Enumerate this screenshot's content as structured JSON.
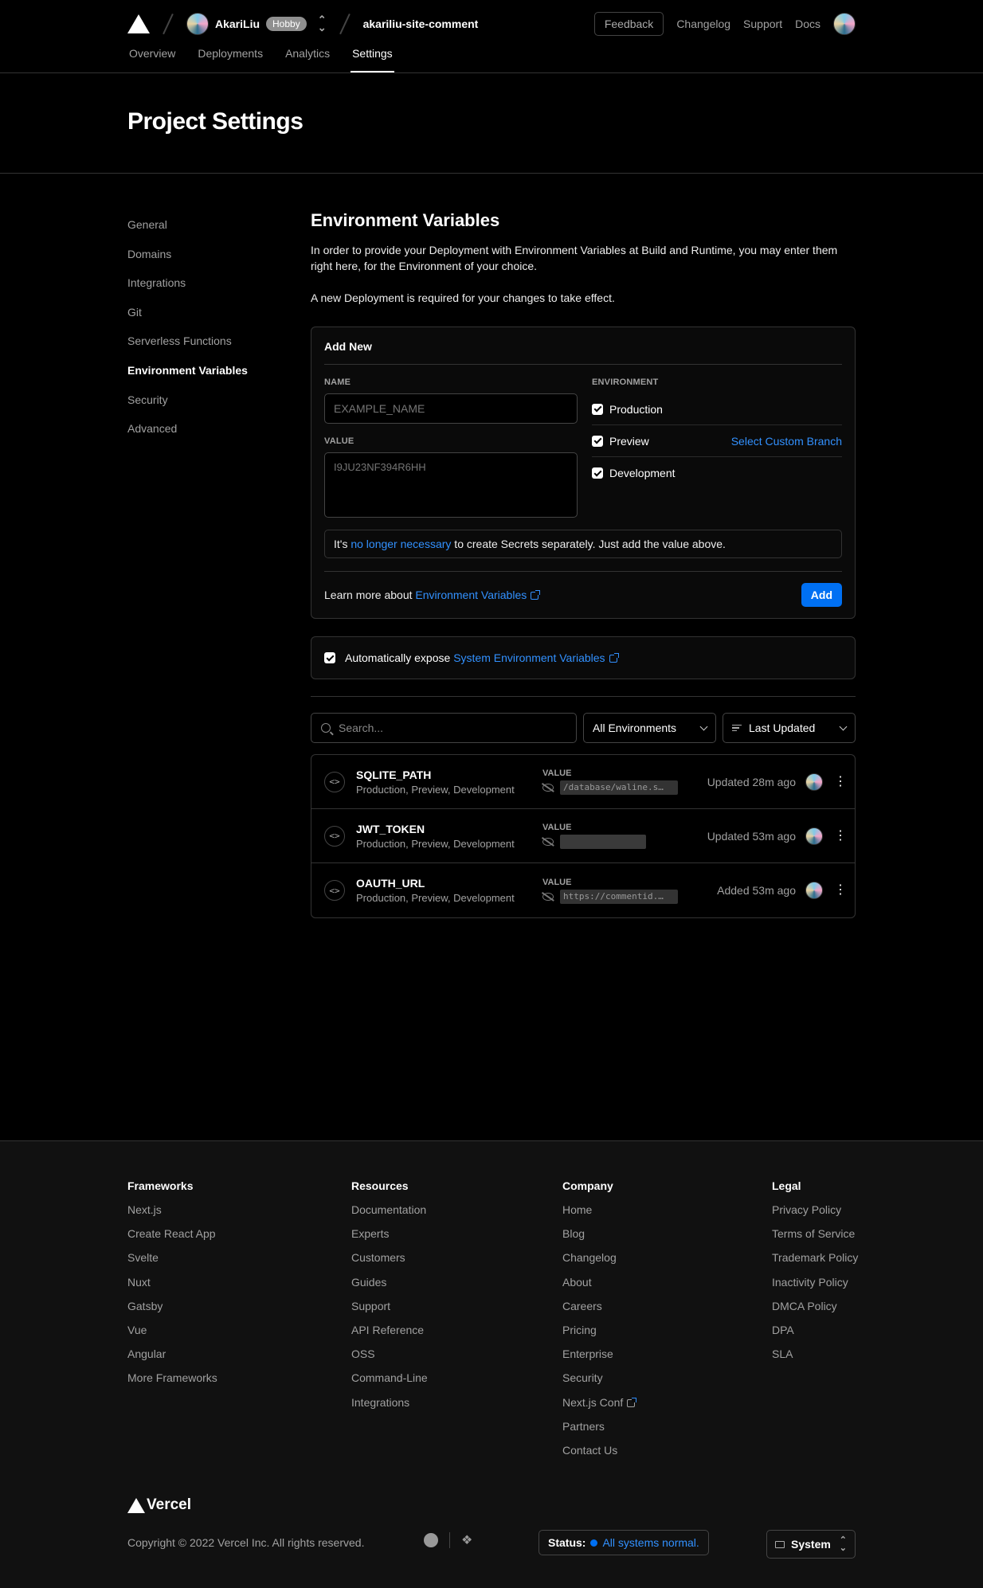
{
  "header": {
    "team_name": "AkariLiu",
    "plan_badge": "Hobby",
    "project_name": "akariliu-site-comment",
    "feedback_label": "Feedback",
    "links": [
      "Changelog",
      "Support",
      "Docs"
    ],
    "tabs": [
      "Overview",
      "Deployments",
      "Analytics",
      "Settings"
    ],
    "active_tab": "Settings"
  },
  "page_title": "Project Settings",
  "sidebar": {
    "items": [
      "General",
      "Domains",
      "Integrations",
      "Git",
      "Serverless Functions",
      "Environment Variables",
      "Security",
      "Advanced"
    ],
    "active": "Environment Variables"
  },
  "main": {
    "title": "Environment Variables",
    "description": "In order to provide your Deployment with Environment Variables at Build and Runtime, you may enter them right here, for the Environment of your choice.",
    "redeploy_note": "A new Deployment is required for your changes to take effect.",
    "add_new": {
      "title": "Add New",
      "name_label": "NAME",
      "name_placeholder": "EXAMPLE_NAME",
      "value_label": "VALUE",
      "value_placeholder": "I9JU23NF394R6HH",
      "environment_label": "ENVIRONMENT",
      "environments": [
        "Production",
        "Preview",
        "Development"
      ],
      "custom_branch_link": "Select Custom Branch",
      "secrets_note_pre": "It's ",
      "secrets_note_link": "no longer necessary",
      "secrets_note_post": " to create Secrets separately. Just add the value above.",
      "learn_more_pre": "Learn more about ",
      "learn_more_link": "Environment Variables",
      "add_button": "Add"
    },
    "expose": {
      "label_pre": "Automatically expose ",
      "label_link": "System Environment Variables"
    },
    "filters": {
      "search_placeholder": "Search...",
      "env_select": "All Environments",
      "sort_select": "Last Updated"
    },
    "variables": [
      {
        "name": "SQLITE_PATH",
        "envs": "Production, Preview, Development",
        "value_label": "VALUE",
        "value": "/database/waline.s…",
        "updated": "Updated 28m ago"
      },
      {
        "name": "JWT_TOKEN",
        "envs": "Production, Preview, Development",
        "value_label": "VALUE",
        "value": "",
        "updated": "Updated 53m ago"
      },
      {
        "name": "OAUTH_URL",
        "envs": "Production, Preview, Development",
        "value_label": "VALUE",
        "value": "https://commentid.…",
        "updated": "Added 53m ago"
      }
    ]
  },
  "footer": {
    "columns": [
      {
        "title": "Frameworks",
        "links": [
          "Next.js",
          "Create React App",
          "Svelte",
          "Nuxt",
          "Gatsby",
          "Vue",
          "Angular",
          "More Frameworks"
        ]
      },
      {
        "title": "Resources",
        "links": [
          "Documentation",
          "Experts",
          "Customers",
          "Guides",
          "Support",
          "API Reference",
          "OSS",
          "Command-Line",
          "Integrations"
        ]
      },
      {
        "title": "Company",
        "links": [
          "Home",
          "Blog",
          "Changelog",
          "About",
          "Careers",
          "Pricing",
          "Enterprise",
          "Security",
          "Next.js Conf",
          "Partners",
          "Contact Us"
        ]
      },
      {
        "title": "Legal",
        "links": [
          "Privacy Policy",
          "Terms of Service",
          "Trademark Policy",
          "Inactivity Policy",
          "DMCA Policy",
          "DPA",
          "SLA"
        ]
      }
    ],
    "brand": "Vercel",
    "copyright": "Copyright © 2022 Vercel Inc. All rights reserved.",
    "status_label": "Status:",
    "status_text": "All systems normal.",
    "theme": "System"
  },
  "colors": {
    "accent": "#0070f3",
    "link": "#3291ff",
    "background": "#000000"
  }
}
